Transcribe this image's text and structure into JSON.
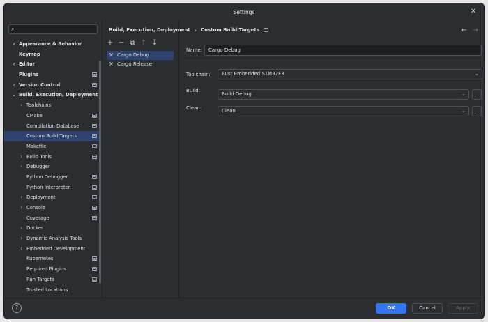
{
  "window": {
    "title": "Settings"
  },
  "search": {
    "placeholder": ""
  },
  "tree": [
    {
      "label": "Appearance & Behavior",
      "bold": true,
      "arrow": "›",
      "indent": 0,
      "cfg": false
    },
    {
      "label": "Keymap",
      "bold": true,
      "arrow": "",
      "indent": 0,
      "cfg": false
    },
    {
      "label": "Editor",
      "bold": true,
      "arrow": "›",
      "indent": 0,
      "cfg": false
    },
    {
      "label": "Plugins",
      "bold": true,
      "arrow": "",
      "indent": 0,
      "cfg": true
    },
    {
      "label": "Version Control",
      "bold": true,
      "arrow": "›",
      "indent": 0,
      "cfg": true
    },
    {
      "label": "Build, Execution, Deployment",
      "bold": true,
      "arrow": "⌄",
      "indent": 0,
      "cfg": false
    },
    {
      "label": "Toolchains",
      "bold": false,
      "arrow": "›",
      "indent": 1,
      "cfg": false
    },
    {
      "label": "CMake",
      "bold": false,
      "arrow": "",
      "indent": 1,
      "cfg": true
    },
    {
      "label": "Compilation Database",
      "bold": false,
      "arrow": "",
      "indent": 1,
      "cfg": true
    },
    {
      "label": "Custom Build Targets",
      "bold": false,
      "arrow": "",
      "indent": 1,
      "cfg": true,
      "selected": true
    },
    {
      "label": "Makefile",
      "bold": false,
      "arrow": "",
      "indent": 1,
      "cfg": true
    },
    {
      "label": "Build Tools",
      "bold": false,
      "arrow": "›",
      "indent": 1,
      "cfg": true
    },
    {
      "label": "Debugger",
      "bold": false,
      "arrow": "›",
      "indent": 1,
      "cfg": false
    },
    {
      "label": "Python Debugger",
      "bold": false,
      "arrow": "",
      "indent": 1,
      "cfg": true
    },
    {
      "label": "Python Interpreter",
      "bold": false,
      "arrow": "",
      "indent": 1,
      "cfg": true
    },
    {
      "label": "Deployment",
      "bold": false,
      "arrow": "›",
      "indent": 1,
      "cfg": true
    },
    {
      "label": "Console",
      "bold": false,
      "arrow": "›",
      "indent": 1,
      "cfg": true
    },
    {
      "label": "Coverage",
      "bold": false,
      "arrow": "",
      "indent": 1,
      "cfg": true
    },
    {
      "label": "Docker",
      "bold": false,
      "arrow": "›",
      "indent": 1,
      "cfg": false
    },
    {
      "label": "Dynamic Analysis Tools",
      "bold": false,
      "arrow": "›",
      "indent": 1,
      "cfg": false
    },
    {
      "label": "Embedded Development",
      "bold": false,
      "arrow": "›",
      "indent": 1,
      "cfg": false
    },
    {
      "label": "Kubernetes",
      "bold": false,
      "arrow": "",
      "indent": 1,
      "cfg": true
    },
    {
      "label": "Required Plugins",
      "bold": false,
      "arrow": "",
      "indent": 1,
      "cfg": true
    },
    {
      "label": "Run Targets",
      "bold": false,
      "arrow": "",
      "indent": 1,
      "cfg": true
    },
    {
      "label": "Trusted Locations",
      "bold": false,
      "arrow": "",
      "indent": 1,
      "cfg": false
    }
  ],
  "breadcrumb": {
    "parent": "Build, Execution, Deployment",
    "separator": "›",
    "current": "Custom Build Targets"
  },
  "nav": {
    "back": "←",
    "forward": "→"
  },
  "toolbar": {
    "add": "+",
    "remove": "−",
    "copy": "⧉",
    "move_up": "↑",
    "move_down": "↧"
  },
  "targets": [
    {
      "label": "Cargo Debug",
      "selected": true
    },
    {
      "label": "Cargo Release",
      "selected": false
    }
  ],
  "form": {
    "name_label": "Name:",
    "name_value": "Cargo Debug",
    "toolchain_label": "Toolchain:",
    "toolchain_value": "Rust Embedded STM32F3",
    "build_label": "Build:",
    "build_value": "Build Debug",
    "clean_label": "Clean:",
    "clean_value": "Clean",
    "ellipsis": "..."
  },
  "footer": {
    "help": "?",
    "ok": "OK",
    "cancel": "Cancel",
    "apply": "Apply"
  },
  "colors": {
    "accent": "#3574f0",
    "selection": "#2e436e",
    "background": "#2b2d30"
  }
}
